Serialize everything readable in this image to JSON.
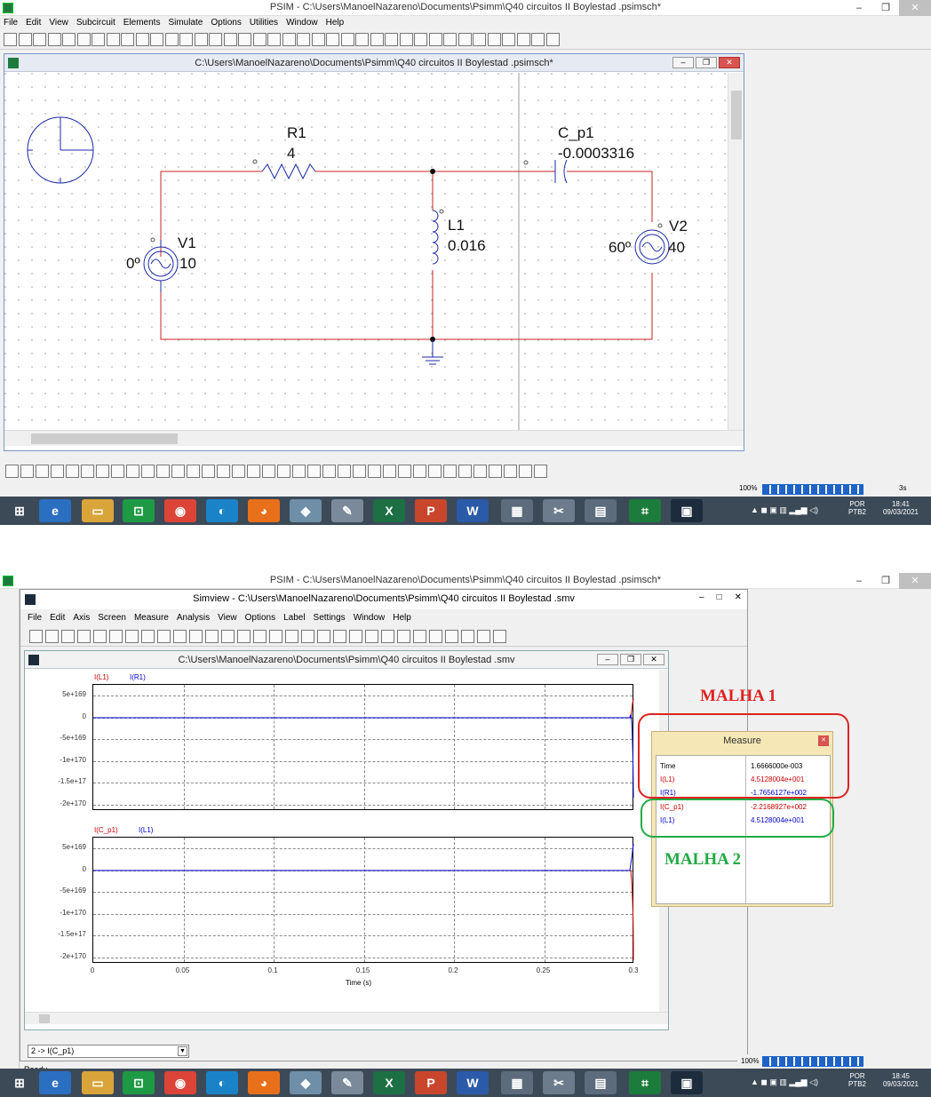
{
  "top": {
    "window_title": "PSIM - C:\\Users\\ManoelNazareno\\Documents\\Psimm\\Q40 circuitos II Boylestad .psimsch*",
    "menu": [
      "File",
      "Edit",
      "View",
      "Subcircuit",
      "Elements",
      "Simulate",
      "Options",
      "Utilities",
      "Window",
      "Help"
    ],
    "doc_title": "C:\\Users\\ManoelNazareno\\Documents\\Psimm\\Q40 circuitos II Boylestad .psimsch*",
    "circuit": {
      "r1_name": "R1",
      "r1_value": "4",
      "c_name": "C_p1",
      "c_value": "-0.0003316",
      "l_name": "L1",
      "l_value": "0.016",
      "v1_name": "V1",
      "v1_phase": "0º",
      "v1_value": "10",
      "v2_name": "V2",
      "v2_phase": "60º",
      "v2_value": "40"
    },
    "zoom": "100%",
    "time_readout": "3s"
  },
  "bottom": {
    "window_title": "PSIM - C:\\Users\\ManoelNazareno\\Documents\\Psimm\\Q40 circuitos II Boylestad .psimsch*",
    "simview_title": "Simview - C:\\Users\\ManoelNazareno\\Documents\\Psimm\\Q40 circuitos II Boylestad .smv",
    "simview_menu": [
      "File",
      "Edit",
      "Axis",
      "Screen",
      "Measure",
      "Analysis",
      "View",
      "Options",
      "Label",
      "Settings",
      "Window",
      "Help"
    ],
    "plot_doc_title": "C:\\Users\\ManoelNazareno\\Documents\\Psimm\\Q40 circuitos II Boylestad .smv",
    "plot1_legend": [
      "I(L1)",
      "I(R1)"
    ],
    "plot2_legend": [
      "I(C_p1)",
      "I(L1)"
    ],
    "y_ticks": [
      "5e+169",
      "0",
      "-5e+169",
      "-1e+170",
      "-1.5e+17",
      "-2e+170"
    ],
    "x_ticks": [
      "0",
      "0.05",
      "0.1",
      "0.15",
      "0.2",
      "0.25",
      "0.3"
    ],
    "x_label": "Time (s)",
    "selector_value": "2 -> I(C_p1)",
    "status": "Ready",
    "zoom": "100%",
    "measure": {
      "title": "Measure",
      "rows": [
        {
          "k": "Time",
          "v": "1.6666000e-003"
        },
        {
          "k": "I(L1)",
          "v": "4.5128004e+001"
        },
        {
          "k": "I(R1)",
          "v": "-1.7656127e+002"
        },
        {
          "k": "I(C_p1)",
          "v": "-2.2168927e+002"
        },
        {
          "k": "I(L1)",
          "v": "4.5128004e+001"
        }
      ]
    },
    "annotation_1": "MALHA 1",
    "annotation_2": "MALHA 2"
  },
  "taskbar_top": {
    "lang": "POR",
    "lang2": "PTB2",
    "time": "18:41",
    "date": "09/03/2021"
  },
  "taskbar_bottom": {
    "lang": "POR",
    "lang2": "PTB2",
    "time": "18:45",
    "date": "09/03/2021"
  },
  "colors": {
    "wire": "#cc2222",
    "component": "#1a2aa8",
    "series_red": "#cc0000",
    "series_blue": "#0000cc",
    "annot_red": "#dd2222",
    "annot_green": "#22aa44"
  },
  "chart_data": [
    {
      "type": "line",
      "x_label": "Time (s)",
      "xlim": [
        0,
        0.3
      ],
      "y_ticks": [
        "5e+169",
        "0",
        "-5e+169",
        "-1e+170",
        "-1.5e+17",
        "-2e+170"
      ],
      "series": [
        {
          "name": "I(L1)"
        },
        {
          "name": "I(R1)"
        }
      ]
    },
    {
      "type": "line",
      "x_label": "Time (s)",
      "xlim": [
        0,
        0.3
      ],
      "y_ticks": [
        "5e+169",
        "0",
        "-5e+169",
        "-1e+170",
        "-1.5e+17",
        "-2e+170"
      ],
      "series": [
        {
          "name": "I(C_p1)"
        },
        {
          "name": "I(L1)"
        }
      ]
    }
  ]
}
